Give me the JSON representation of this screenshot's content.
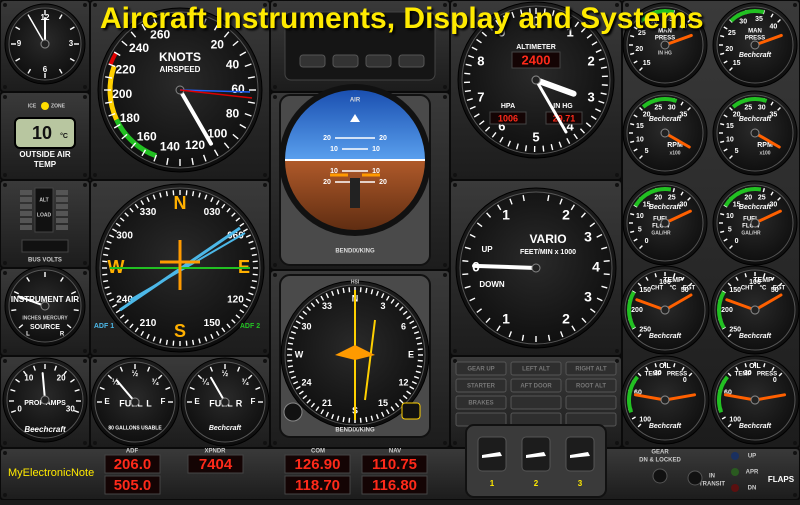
{
  "title": "Aircraft Instruments, Display and Systems",
  "credit": "MyElectronicNote",
  "airspeed": {
    "unit": "KNOTS",
    "sub": "AIRSPEED",
    "ticks": [
      "20",
      "40",
      "60",
      "80",
      "100",
      "120",
      "140",
      "160",
      "180",
      "200",
      "220",
      "240",
      "260"
    ]
  },
  "altimeter": {
    "label": "ALTIMETER",
    "readout": "2400",
    "hpa_label": "HPA",
    "hpa_value": "1006",
    "inhg_label": "IN HG",
    "inhg_value": "29.71",
    "ticks": [
      "0",
      "1",
      "2",
      "3",
      "4",
      "5",
      "6",
      "7",
      "8",
      "9"
    ]
  },
  "oat": {
    "top_left": "ICE",
    "top_right": "ZONE",
    "value": "10",
    "unit": "°C",
    "label1": "OUTSIDE AIR",
    "label2": "TEMP"
  },
  "attitude": {
    "top": "AIR",
    "brand": "BENDIX/KING",
    "pitch": [
      "20",
      "10",
      "10",
      "20"
    ]
  },
  "heading": {
    "brand": "BENDIX/KING",
    "top": "HSI",
    "cardinals": [
      "N",
      "E",
      "S",
      "W"
    ],
    "numbers": [
      "3",
      "6",
      "12",
      "15",
      "21",
      "24",
      "30",
      "33"
    ]
  },
  "adf": {
    "cardinals": [
      "N",
      "E",
      "S",
      "W"
    ],
    "numbers": [
      "030",
      "060",
      "120",
      "150",
      "210",
      "240",
      "300",
      "330"
    ],
    "adf1": "ADF 1",
    "adf2": "ADF 2"
  },
  "vario": {
    "label": "VARIO",
    "sub": "FEET/MIN x 1000",
    "up": "UP",
    "down": "DOWN",
    "ticks": [
      "0",
      "1",
      "2",
      "3",
      "4",
      "3",
      "2",
      "1"
    ]
  },
  "instrument_air": {
    "label": "INSTRUMENT AIR",
    "sub": "INCHES MERCURY",
    "source": "SOURCE",
    "l": "L",
    "r": "R"
  },
  "bus": {
    "label": "BUS VOLTS",
    "segs": [
      "ALT",
      "LOAD"
    ]
  },
  "props": {
    "label": "PROP AMPS",
    "brand": "Beechcraft",
    "ticks": [
      "0",
      "10",
      "20",
      "30"
    ]
  },
  "fuel_left": {
    "label": "FUEL",
    "side": "L",
    "usable": "80 GALLONS USABLE",
    "ticks": [
      "E",
      "¼",
      "½",
      "¾",
      "F"
    ]
  },
  "fuel_right": {
    "label": "FUEL",
    "side": "R",
    "brand": "Bechcraft",
    "ticks": [
      "E",
      "¼",
      "½",
      "¾",
      "F"
    ]
  },
  "man_press": [
    {
      "label": "MAN PRESS",
      "unit": "IN HG",
      "ticks": [
        "15",
        "20",
        "25",
        "30",
        "35",
        "40"
      ]
    },
    {
      "label": "MAN PRESS",
      "brand": "Bechcraft",
      "ticks": [
        "15",
        "20",
        "25",
        "30",
        "35",
        "40"
      ]
    }
  ],
  "rpm": [
    {
      "label": "RPM",
      "unit": "x100",
      "brand": "Bechcraft",
      "ticks": [
        "5",
        "10",
        "15",
        "20",
        "25",
        "30",
        "35"
      ]
    },
    {
      "label": "RPM",
      "unit": "x100",
      "brand": "Bechcraft",
      "ticks": [
        "5",
        "10",
        "15",
        "20",
        "25",
        "30",
        "35"
      ]
    }
  ],
  "fuel_flow": [
    {
      "label": "FUEL FLOW",
      "unit": "GAL/HR",
      "brand": "Bechcraft",
      "ticks": [
        "0",
        "5",
        "10",
        "15",
        "20",
        "25",
        "30"
      ]
    },
    {
      "label": "FUEL FLOW",
      "unit": "GAL/HR",
      "brand": "Bechcraft",
      "ticks": [
        "0",
        "5",
        "10",
        "15",
        "20",
        "25",
        "30"
      ]
    }
  ],
  "temp": [
    {
      "label": "TEMP",
      "cht": "CHT",
      "unit": "°C",
      "egt": "EGT",
      "brand": "Bechcraft",
      "ticks": [
        "250",
        "200",
        "150",
        "100",
        "50"
      ]
    },
    {
      "label": "TEMP",
      "cht": "CHT",
      "unit": "°C",
      "egt": "EGT",
      "brand": "Bechcraft",
      "ticks": [
        "250",
        "200",
        "150",
        "100",
        "50"
      ]
    }
  ],
  "oil": [
    {
      "label": "OIL",
      "temp": "TEMP",
      "press": "PRESS",
      "brand": "Bechcraft",
      "ticks": [
        "100",
        "60",
        "30",
        "0"
      ]
    },
    {
      "label": "OIL",
      "temp": "TEMP",
      "press": "PRESS",
      "brand": "Bechcraft",
      "ticks": [
        "100",
        "60",
        "30",
        "0"
      ]
    }
  ],
  "annunciators": [
    "GEAR UP",
    "LEFT ALT",
    "RIGHT ALT",
    "STARTER",
    "AFT DOOR",
    "ROOT ALT",
    "BRAKES",
    "",
    ""
  ],
  "radios": {
    "adf_label": "ADF",
    "xpndr_label": "XPNDR",
    "com_label": "COM",
    "nav_label": "NAV",
    "adf_active": "206.0",
    "adf_standby": "505.0",
    "xpndr": "7404",
    "com_active": "126.90",
    "com_standby": "118.70",
    "nav_active": "110.75",
    "nav_standby": "116.80"
  },
  "flaps": {
    "label": "FLAPS",
    "positions": [
      "1",
      "2",
      "3"
    ],
    "up": "UP",
    "apr": "APR",
    "dn": "DN"
  },
  "gear": {
    "label1": "GEAR",
    "label2": "DN & LOCKED",
    "in_transit1": "IN",
    "in_transit2": "TRANSIT"
  },
  "clock": {
    "ticks": [
      "12",
      "3",
      "6",
      "9"
    ]
  },
  "colors": {
    "yellow": "#ffea00",
    "bezel": "#0b0b0b",
    "panel": "#2a2a2a",
    "red_led": "#ff2a1a",
    "green": "#22c022"
  }
}
